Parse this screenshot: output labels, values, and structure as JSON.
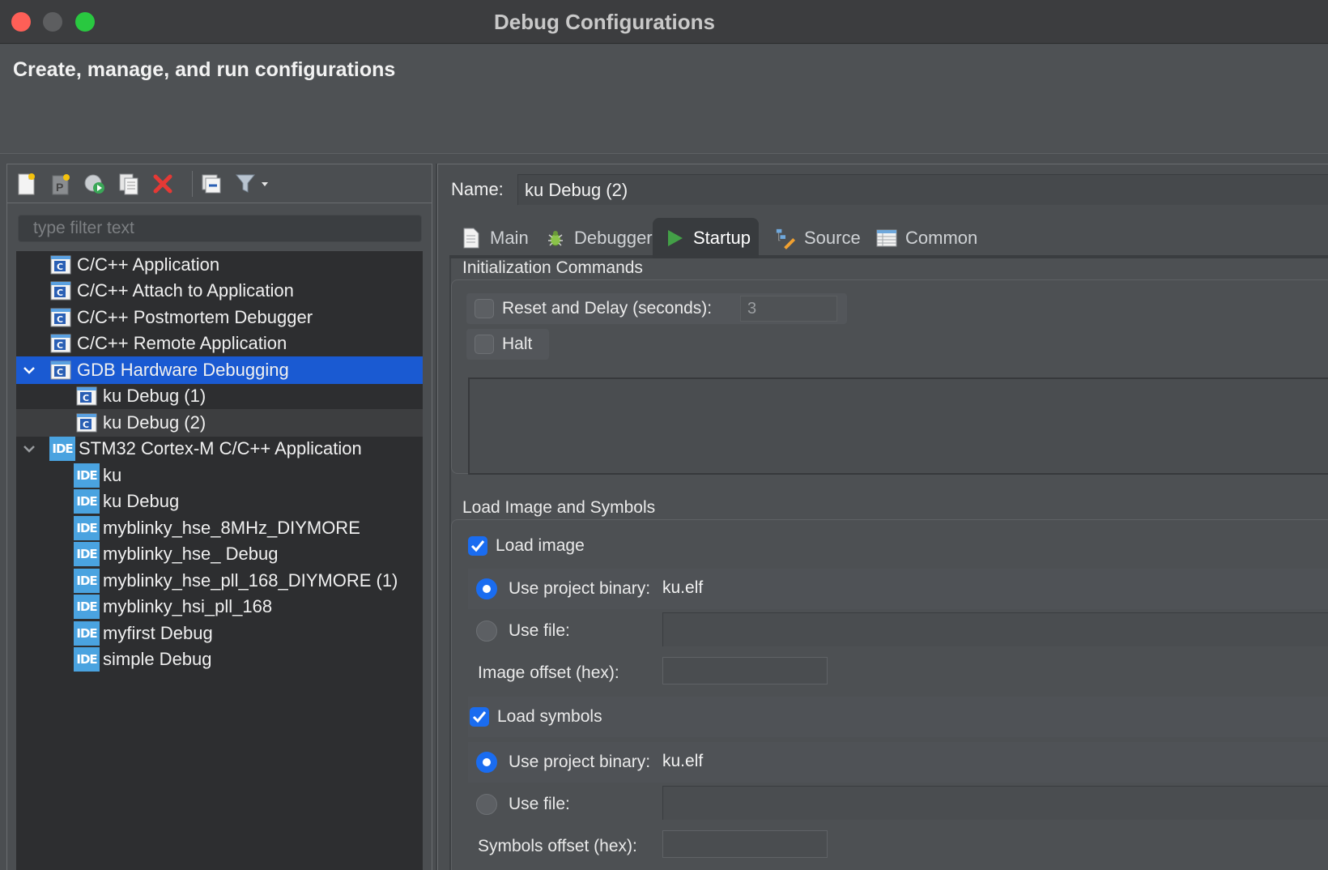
{
  "window": {
    "title": "Debug Configurations"
  },
  "header": {
    "title": "Create, manage, and run configurations"
  },
  "sidebar": {
    "filter_placeholder": "type filter text",
    "tree": [
      {
        "label": "C/C++ Application",
        "icon": "c-config-icon",
        "level": 0
      },
      {
        "label": "C/C++ Attach to Application",
        "icon": "c-config-icon",
        "level": 0
      },
      {
        "label": "C/C++ Postmortem Debugger",
        "icon": "c-config-icon",
        "level": 0
      },
      {
        "label": "C/C++ Remote Application",
        "icon": "c-config-icon",
        "level": 0
      },
      {
        "label": "GDB Hardware Debugging",
        "icon": "c-config-icon",
        "level": 0,
        "expanded": true,
        "selected": true
      },
      {
        "label": "ku Debug (1)",
        "icon": "c-config-icon",
        "level": 1
      },
      {
        "label": "ku Debug (2)",
        "icon": "c-config-icon",
        "level": 1,
        "highlighted": true
      },
      {
        "label": "STM32 Cortex-M C/C++ Application",
        "icon": "ide-icon",
        "level": 0,
        "expanded": true
      },
      {
        "label": "ku",
        "icon": "ide-icon",
        "level": 1
      },
      {
        "label": "ku Debug",
        "icon": "ide-icon",
        "level": 1
      },
      {
        "label": "myblinky_hse_8MHz_DIYMORE",
        "icon": "ide-icon",
        "level": 1
      },
      {
        "label": "myblinky_hse_ Debug",
        "icon": "ide-icon",
        "level": 1
      },
      {
        "label": "myblinky_hse_pll_168_DIYMORE (1)",
        "icon": "ide-icon",
        "level": 1
      },
      {
        "label": "myblinky_hsi_pll_168",
        "icon": "ide-icon",
        "level": 1
      },
      {
        "label": "myfirst Debug",
        "icon": "ide-icon",
        "level": 1
      },
      {
        "label": "simple Debug",
        "icon": "ide-icon",
        "level": 1
      }
    ],
    "ide_icon_text": "IDE",
    "c_icon_text": "C"
  },
  "config": {
    "name_label": "Name:",
    "name_value": "ku Debug (2)",
    "tabs": [
      {
        "label": "Main",
        "icon": "document-icon"
      },
      {
        "label": "Debugger",
        "icon": "bug-icon"
      },
      {
        "label": "Startup",
        "icon": "play-icon",
        "active": true
      },
      {
        "label": "Source",
        "icon": "source-icon"
      },
      {
        "label": "Common",
        "icon": "table-icon"
      }
    ],
    "init": {
      "title": "Initialization Commands",
      "reset_label": "Reset and Delay (seconds):",
      "reset_checked": false,
      "reset_delay": "3",
      "halt_label": "Halt",
      "halt_checked": false
    },
    "load": {
      "title": "Load Image and Symbols",
      "load_image_label": "Load image",
      "load_image_checked": true,
      "use_project_binary_label": "Use project binary:",
      "image_binary": "ku.elf",
      "use_file_label": "Use file:",
      "image_offset_label": "Image offset (hex):",
      "load_symbols_label": "Load symbols",
      "load_symbols_checked": true,
      "symbols_binary": "ku.elf",
      "symbols_offset_label": "Symbols offset (hex):"
    }
  },
  "colors": {
    "accent": "#1a6cf0",
    "selection": "#1a5ad2",
    "ide_blue": "#4aa3e0"
  }
}
